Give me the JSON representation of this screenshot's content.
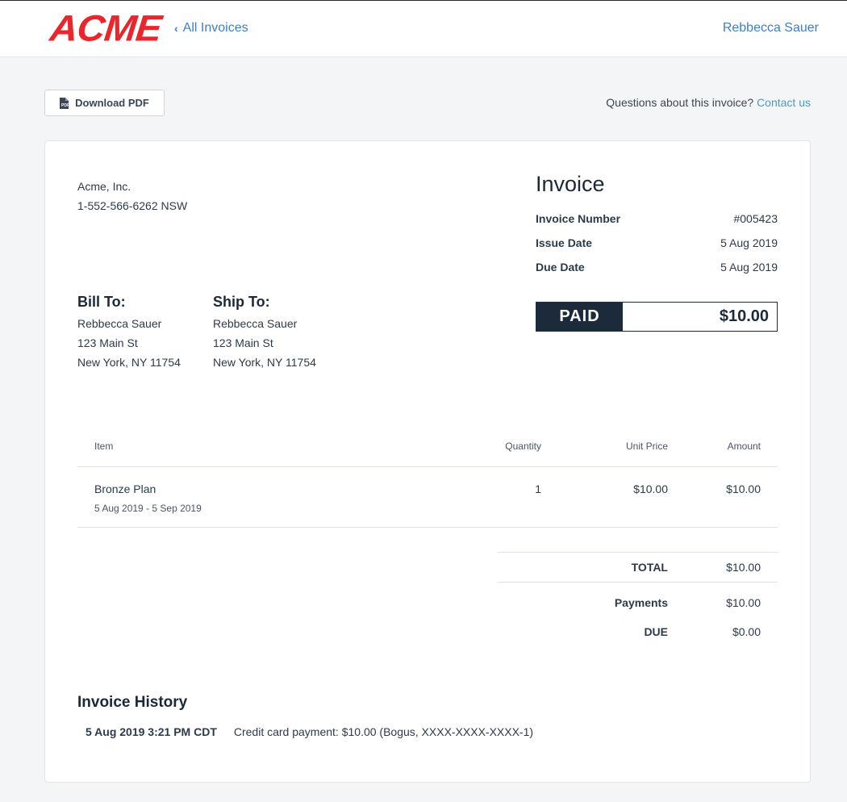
{
  "header": {
    "logo": "ACME",
    "back_link": "All Invoices",
    "user_name": "Rebbecca Sauer"
  },
  "toolbar": {
    "download_label": "Download PDF",
    "questions_text": "Questions about this invoice?",
    "contact_link": "Contact us"
  },
  "from": {
    "company": "Acme, Inc.",
    "phone": "1-552-566-6262 NSW"
  },
  "bill_to": {
    "heading": "Bill To:",
    "name": "Rebbecca Sauer",
    "street": "123 Main St",
    "city": "New York, NY 11754"
  },
  "ship_to": {
    "heading": "Ship To:",
    "name": "Rebbecca Sauer",
    "street": "123 Main St",
    "city": "New York, NY 11754"
  },
  "invoice": {
    "title": "Invoice",
    "meta": [
      {
        "label": "Invoice Number",
        "value": "#005423"
      },
      {
        "label": "Issue Date",
        "value": "5 Aug 2019"
      },
      {
        "label": "Due Date",
        "value": "5 Aug 2019"
      }
    ],
    "status": "PAID",
    "status_amount": "$10.00"
  },
  "items_table": {
    "columns": [
      "Item",
      "Quantity",
      "Unit Price",
      "Amount"
    ],
    "rows": [
      {
        "name": "Bronze Plan",
        "period": "5 Aug 2019 - 5 Sep 2019",
        "quantity": "1",
        "unit_price": "$10.00",
        "amount": "$10.00"
      }
    ]
  },
  "totals": {
    "total_label": "TOTAL",
    "total_value": "$10.00",
    "payments_label": "Payments",
    "payments_value": "$10.00",
    "due_label": "DUE",
    "due_value": "$0.00"
  },
  "history": {
    "title": "Invoice History",
    "entries": [
      {
        "date": "5 Aug 2019 3:21 PM CDT",
        "text": "Credit card payment: $10.00 (Bogus, XXXX-XXXX-XXXX-1)"
      }
    ]
  },
  "colors": {
    "brand": "#e8262c",
    "link": "#3d7fc6",
    "dark": "#1c2b3c"
  }
}
